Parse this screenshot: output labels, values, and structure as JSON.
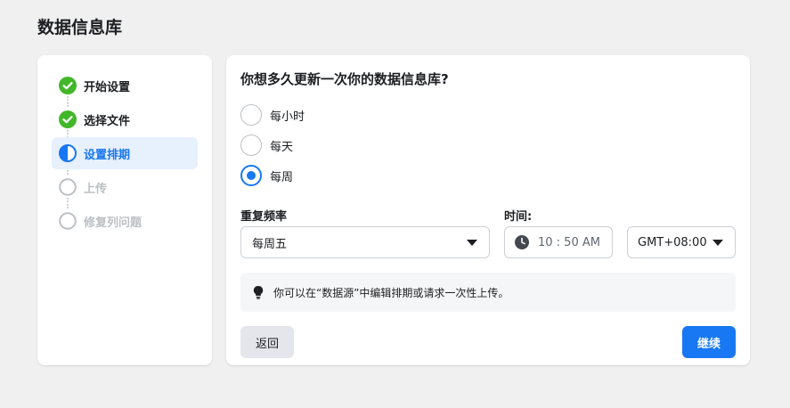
{
  "page": {
    "title": "数据信息库"
  },
  "steps": [
    {
      "label": "开始设置",
      "state": "done"
    },
    {
      "label": "选择文件",
      "state": "done"
    },
    {
      "label": "设置排期",
      "state": "active"
    },
    {
      "label": "上传",
      "state": "todo"
    },
    {
      "label": "修复列问题",
      "state": "todo"
    }
  ],
  "schedule": {
    "question": "你想多久更新一次你的数据信息库?",
    "options": [
      {
        "label": "每小时",
        "checked": false
      },
      {
        "label": "每天",
        "checked": false
      },
      {
        "label": "每周",
        "checked": true
      }
    ],
    "repeat_label": "重复频率",
    "repeat_value": "每周五",
    "time_label": "时间:",
    "time_value": "10 : 50 AM",
    "timezone_value": "GMT+08:00",
    "tip": "你可以在“数据源”中编辑排期或请求一次性上传。"
  },
  "buttons": {
    "back": "返回",
    "next": "继续"
  },
  "colors": {
    "accent": "#1877f2",
    "done": "#42b72a"
  }
}
